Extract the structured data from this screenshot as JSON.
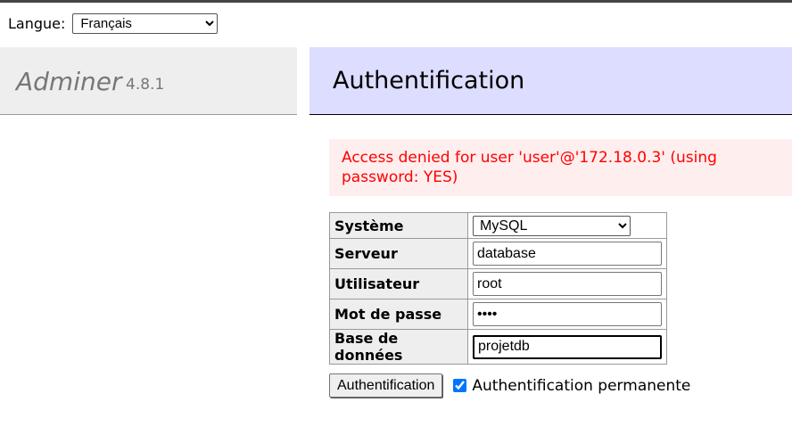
{
  "language": {
    "label": "Langue:",
    "selected": "Français"
  },
  "menu": {
    "app_name": "Adminer",
    "version": "4.8.1"
  },
  "header": {
    "title": "Authentification"
  },
  "error": {
    "message": "Access denied for user 'user'@'172.18.0.3' (using password: YES)"
  },
  "form": {
    "fields": [
      {
        "label": "Système",
        "value": "MySQL",
        "type": "select"
      },
      {
        "label": "Serveur",
        "value": "database",
        "type": "text"
      },
      {
        "label": "Utilisateur",
        "value": "root",
        "type": "text"
      },
      {
        "label": "Mot de passe",
        "value": "••••",
        "type": "password"
      },
      {
        "label": "Base de données",
        "value": "projetdb",
        "type": "text"
      }
    ],
    "submit_label": "Authentification",
    "permanent_label": "Authentification permanente",
    "permanent_checked": true
  },
  "colors": {
    "menu_bg": "#eeeeee",
    "header_bg": "#ddddff",
    "error_bg": "#ffeeee",
    "error_text": "#ff0000",
    "checkbox_accent": "#0075ff"
  }
}
